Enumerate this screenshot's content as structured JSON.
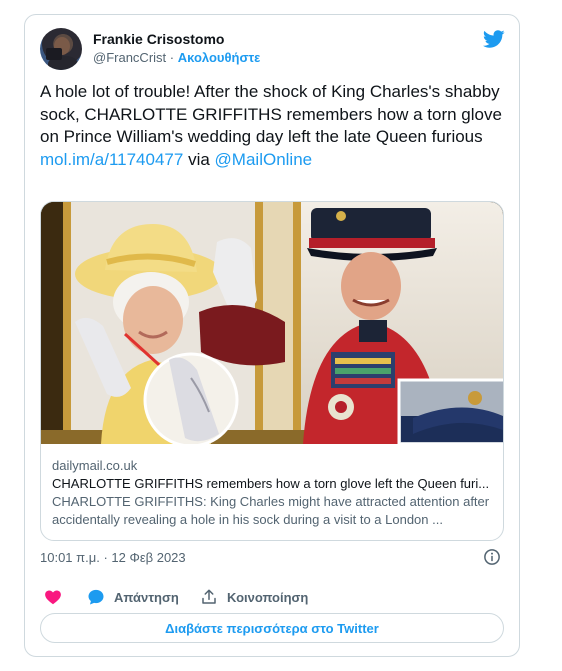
{
  "author": {
    "display_name": "Frankie Crisostomo",
    "handle": "@FrancCrist",
    "separator": "·",
    "follow_label": "Ακολουθήστε"
  },
  "tweet": {
    "text": "A hole lot of trouble! After the shock of King Charles's shabby sock, CHARLOTTE GRIFFITHS remembers how a torn glove on Prince William's wedding day left the late Queen furious",
    "link": "mol.im/a/11740477",
    "via": "via",
    "mention": "@MailOnline"
  },
  "link_card": {
    "domain": "dailymail.co.uk",
    "title": "CHARLOTTE GRIFFITHS remembers how a torn glove left the Queen furi...",
    "description": "CHARLOTTE GRIFFITHS: King Charles might have attracted attention after accidentally revealing a hole in his sock during a visit to a London ..."
  },
  "timestamp": "10:01 π.μ. · 12 Φεβ 2023",
  "actions": {
    "reply_label": "Απάντηση",
    "share_label": "Κοινοποίηση"
  },
  "read_more_label": "Διαβάστε περισσότερα στο Twitter",
  "colors": {
    "accent": "#1d9bf0",
    "like": "#f91880",
    "text": "#0f1419",
    "muted": "#536471",
    "border": "#cfd9de"
  },
  "icons": [
    "twitter-bird-icon",
    "info-icon",
    "heart-icon",
    "reply-bubble-icon",
    "share-icon"
  ]
}
